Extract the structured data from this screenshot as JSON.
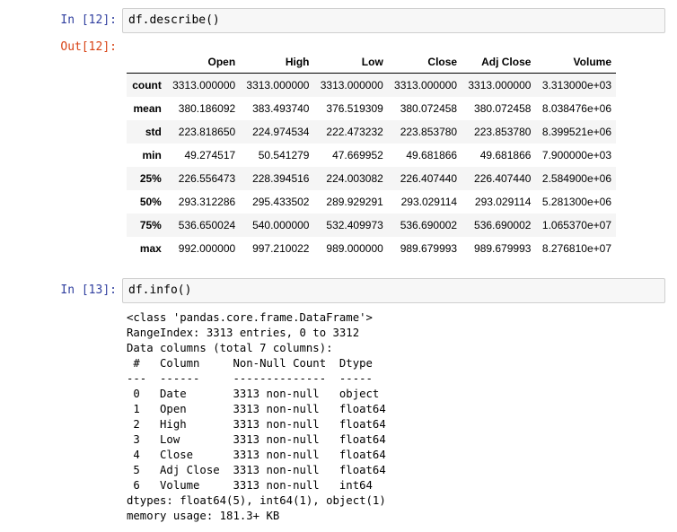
{
  "cell12": {
    "in_prompt": "In [12]:",
    "code": "df.describe()",
    "out_prompt": "Out[12]:"
  },
  "describe_table": {
    "columns": [
      "",
      "Open",
      "High",
      "Low",
      "Close",
      "Adj Close",
      "Volume"
    ],
    "rows": [
      {
        "label": "count",
        "values": [
          "3313.000000",
          "3313.000000",
          "3313.000000",
          "3313.000000",
          "3313.000000",
          "3.313000e+03"
        ]
      },
      {
        "label": "mean",
        "values": [
          "380.186092",
          "383.493740",
          "376.519309",
          "380.072458",
          "380.072458",
          "8.038476e+06"
        ]
      },
      {
        "label": "std",
        "values": [
          "223.818650",
          "224.974534",
          "222.473232",
          "223.853780",
          "223.853780",
          "8.399521e+06"
        ]
      },
      {
        "label": "min",
        "values": [
          "49.274517",
          "50.541279",
          "47.669952",
          "49.681866",
          "49.681866",
          "7.900000e+03"
        ]
      },
      {
        "label": "25%",
        "values": [
          "226.556473",
          "228.394516",
          "224.003082",
          "226.407440",
          "226.407440",
          "2.584900e+06"
        ]
      },
      {
        "label": "50%",
        "values": [
          "293.312286",
          "295.433502",
          "289.929291",
          "293.029114",
          "293.029114",
          "5.281300e+06"
        ]
      },
      {
        "label": "75%",
        "values": [
          "536.650024",
          "540.000000",
          "532.409973",
          "536.690002",
          "536.690002",
          "1.065370e+07"
        ]
      },
      {
        "label": "max",
        "values": [
          "992.000000",
          "997.210022",
          "989.000000",
          "989.679993",
          "989.679993",
          "8.276810e+07"
        ]
      }
    ]
  },
  "cell13": {
    "in_prompt": "In [13]:",
    "code": "df.info()",
    "output_lines": [
      "<class 'pandas.core.frame.DataFrame'>",
      "RangeIndex: 3313 entries, 0 to 3312",
      "Data columns (total 7 columns):",
      " #   Column     Non-Null Count  Dtype  ",
      "---  ------     --------------  -----  ",
      " 0   Date       3313 non-null   object ",
      " 1   Open       3313 non-null   float64",
      " 2   High       3313 non-null   float64",
      " 3   Low        3313 non-null   float64",
      " 4   Close      3313 non-null   float64",
      " 5   Adj Close  3313 non-null   float64",
      " 6   Volume     3313 non-null   int64  ",
      "dtypes: float64(5), int64(1), object(1)",
      "memory usage: 181.3+ KB"
    ]
  },
  "colors": {
    "in_prompt": "#303f9f",
    "out_prompt": "#d84315",
    "input_bg": "#f7f7f7",
    "input_border": "#cfcfcf",
    "table_stripe": "#f5f5f5"
  }
}
